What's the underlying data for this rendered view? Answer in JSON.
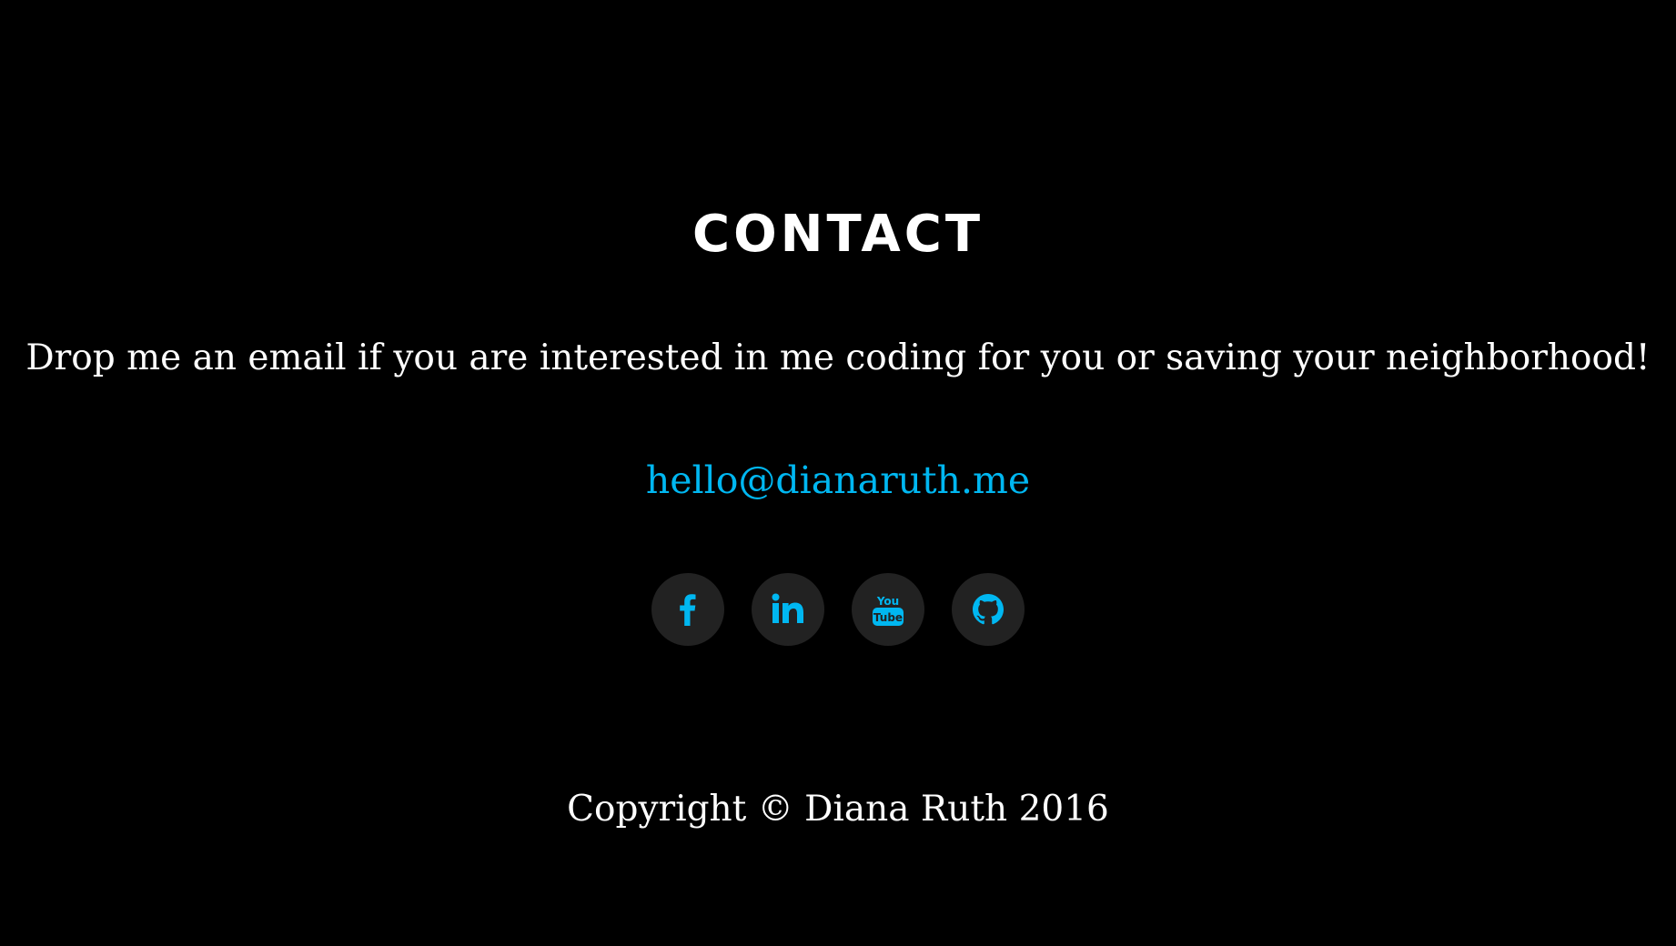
{
  "contact": {
    "heading": "CONTACT",
    "intro": "Drop me an email if you are interested in me coding for you or saving your neighborhood!",
    "email": "hello@dianaruth.me"
  },
  "social": {
    "icons": [
      "facebook-icon",
      "linkedin-icon",
      "youtube-icon",
      "github-icon"
    ],
    "icon_color": "#00b7f1",
    "button_bg": "#222222"
  },
  "footer": {
    "copyright": "Copyright © Diana Ruth 2016"
  },
  "colors": {
    "background": "#000000",
    "text": "#ffffff",
    "accent": "#00b7f1"
  }
}
